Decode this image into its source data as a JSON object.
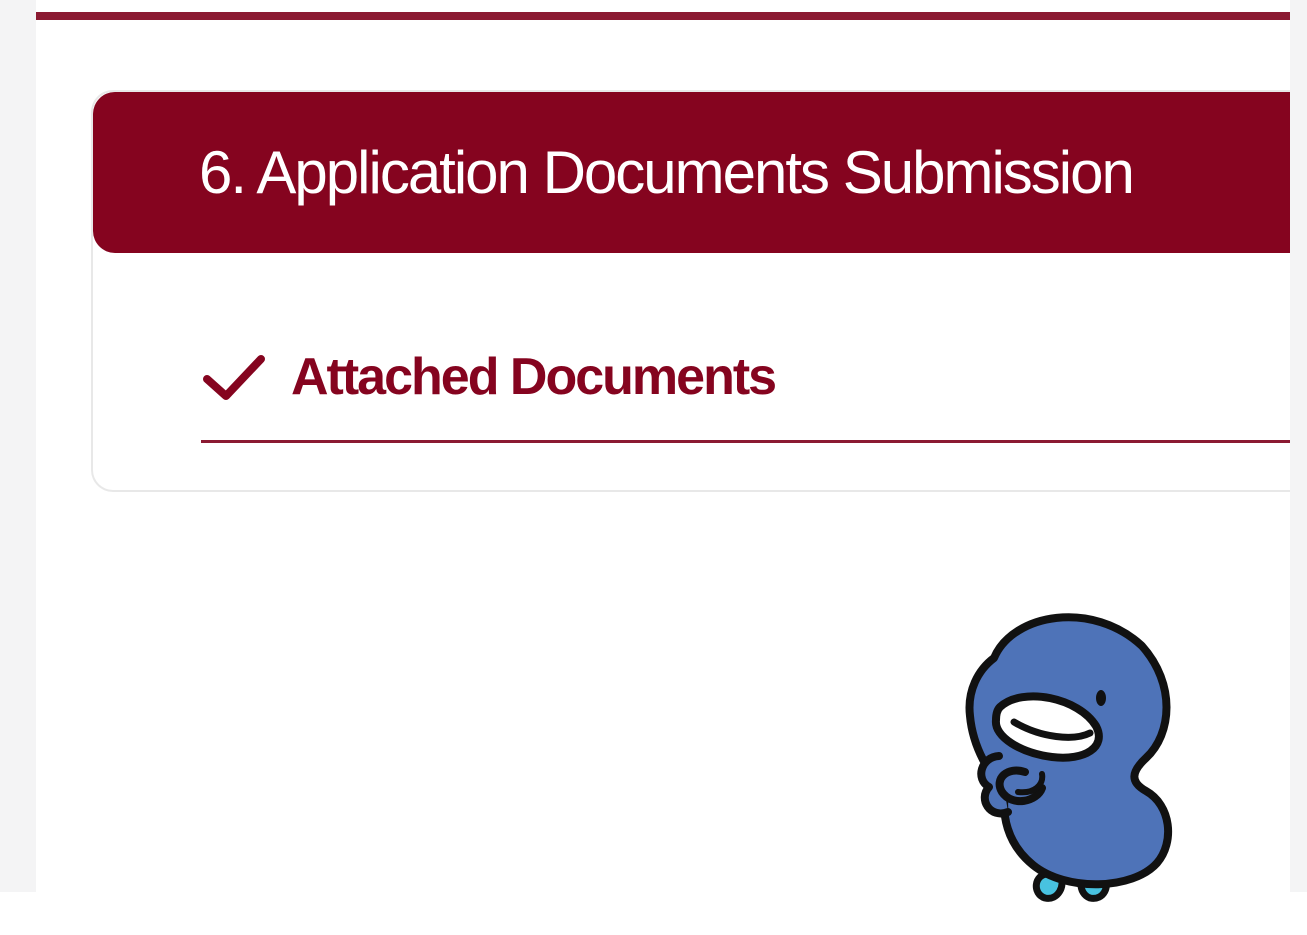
{
  "section": {
    "number": "6.",
    "title": "6. Application Documents Submission"
  },
  "subsection": {
    "title": "Attached Documents",
    "status_icon": "check-icon"
  },
  "mascot": {
    "icon": "blue-bird-mascot"
  },
  "colors": {
    "accent": "#85041f",
    "rule": "#8b1a32",
    "card_border": "#e8e8e8",
    "mascot_body": "#4e73b8",
    "mascot_feet": "#48c2e0"
  }
}
